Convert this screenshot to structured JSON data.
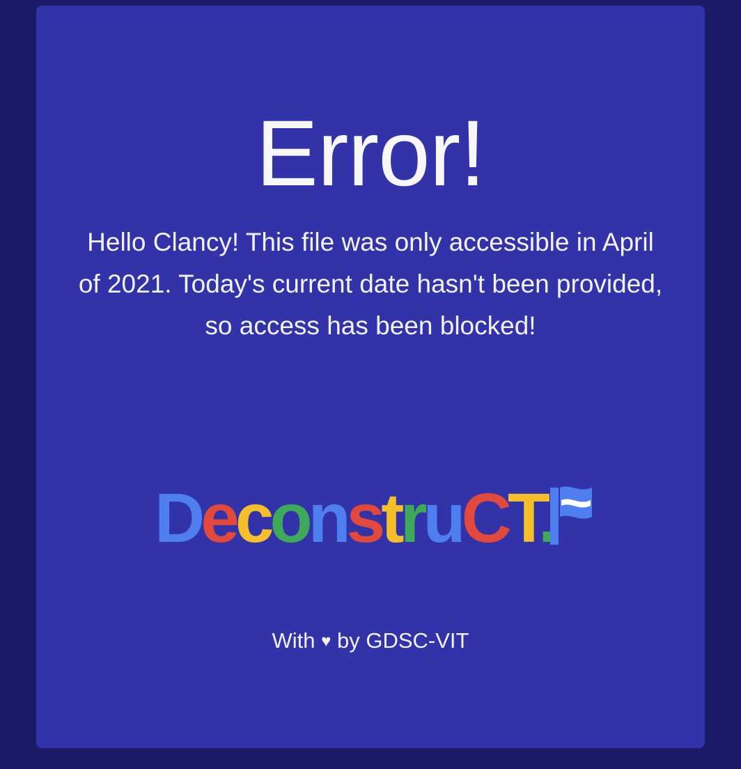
{
  "error": {
    "title": "Error!",
    "message": "Hello Clancy! This file was only accessible in April of 2021. Today's current date hasn't been provided, so access has been blocked!"
  },
  "logo": {
    "wordmark": "DeconstruCT.",
    "letters": [
      {
        "char": "D",
        "color": "#4f7ef1"
      },
      {
        "char": "e",
        "color": "#e0493b"
      },
      {
        "char": "c",
        "color": "#f4bf2a"
      },
      {
        "char": "o",
        "color": "#3ea95a"
      },
      {
        "char": "n",
        "color": "#4f7ef1"
      },
      {
        "char": "s",
        "color": "#e0493b"
      },
      {
        "char": "t",
        "color": "#f4bf2a"
      },
      {
        "char": "r",
        "color": "#3ea95a"
      },
      {
        "char": "u",
        "color": "#4f7ef1"
      },
      {
        "char": "C",
        "color": "#e0493b"
      },
      {
        "char": "T",
        "color": "#f4bf2a"
      },
      {
        "char": ".",
        "color": "#3ea95a"
      }
    ],
    "flag_icon": "flag-icon",
    "flag_color": "#4f7ef1"
  },
  "footer": {
    "prefix": "With",
    "heart_icon": "♥",
    "suffix": "by GDSC-VIT"
  },
  "colors": {
    "background": "#1a1a69",
    "card": "#3233a8",
    "text": "#f7f7f9"
  }
}
